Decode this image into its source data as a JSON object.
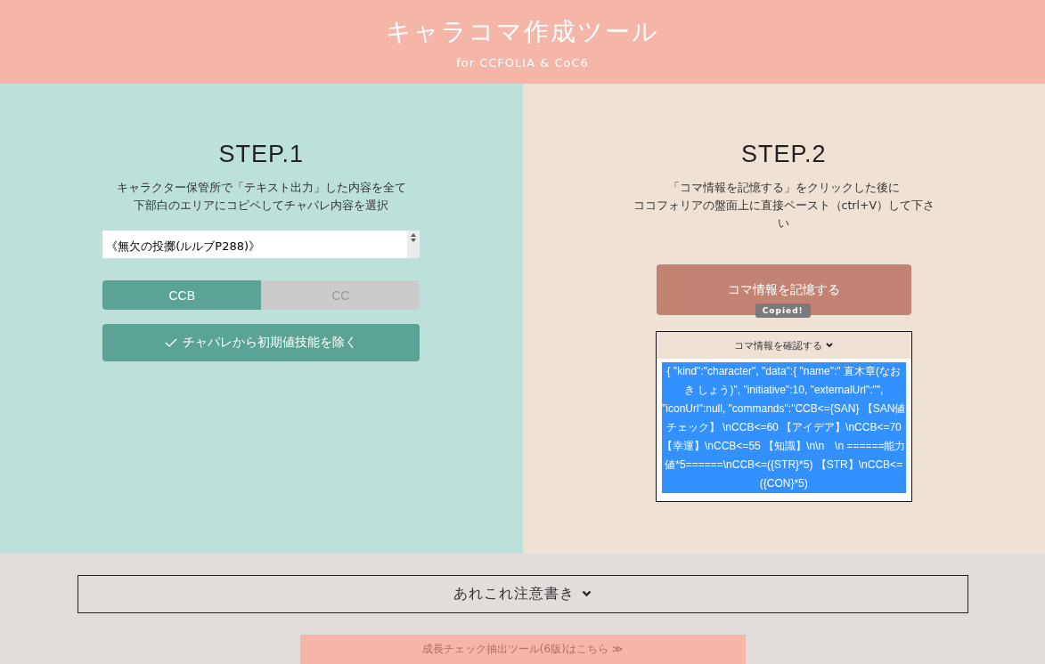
{
  "header": {
    "title": "キャラコマ作成ツール",
    "subtitle": "for CCFOLIA & CoC6"
  },
  "step1": {
    "heading": "STEP.1",
    "description": [
      "キャラクター保管所で「テキスト出力」した内容を全て",
      "下部白のエリアにコピペしてチャパレ内容を選択"
    ],
    "textarea_value": "《無欠の投擲(ルルブP288)》",
    "mode_options": [
      {
        "label": "CCB",
        "selected": true
      },
      {
        "label": "CC",
        "selected": false
      }
    ],
    "exclude_initial_skills": {
      "label": "チャパレから初期値技能を除く",
      "checked": true
    }
  },
  "step2": {
    "heading": "STEP.2",
    "description": [
      "「コマ情報を記憶する」をクリックした後に",
      "ココフォリアの盤面上に直接ペースト（ctrl+V）して下さい"
    ],
    "copy_button": "コマ情報を記憶する",
    "tooltip": "Copied!",
    "details_summary": "コマ情報を確認する",
    "output": "{ \"kind\":\"character\", \"data\":{ \"name\":\" 直木章(なおき しょう)\", \"initiative\":10, \"externalUrl\":\"\", \"iconUrl\":null, \"commands\":\"CCB<={SAN} 【SAN値チェック】 \\nCCB<=60 【アイデア】\\nCCB<=70 【幸運】\\nCCB<=55 【知識】\\n\\n　\\n ======能力値*5======\\nCCB<=({STR}*5) 【STR】\\nCCB<=({CON}*5)",
    "output_selected": true
  },
  "notes_toggle": "あれこれ注意書き",
  "growth_link": "成長チェック抽出ツール(6版)はこちら ≫"
}
